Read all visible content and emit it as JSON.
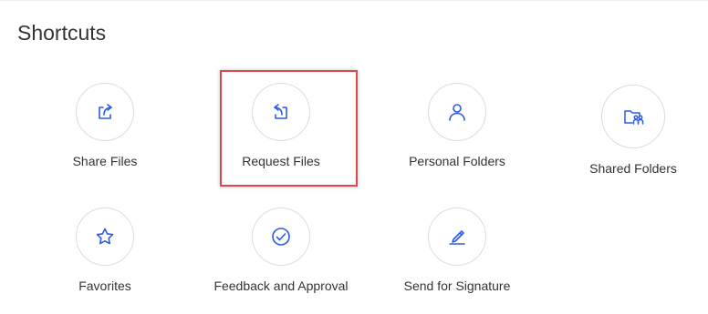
{
  "section": {
    "title": "Shortcuts"
  },
  "colors": {
    "icon": "#2c5ce6",
    "highlight": "#e0484e",
    "circle_border": "#dcdcdc"
  },
  "shortcuts": [
    {
      "label": "Share Files",
      "icon": "share-icon"
    },
    {
      "label": "Request Files",
      "icon": "request-icon",
      "highlighted": true
    },
    {
      "label": "Personal Folders",
      "icon": "person-icon"
    },
    {
      "label": "Shared Folders",
      "icon": "shared-folder-icon"
    },
    {
      "label": "Favorites",
      "icon": "star-icon"
    },
    {
      "label": "Feedback and Approval",
      "icon": "checkmark-icon"
    },
    {
      "label": "Send for Signature",
      "icon": "signature-pen-icon"
    }
  ]
}
